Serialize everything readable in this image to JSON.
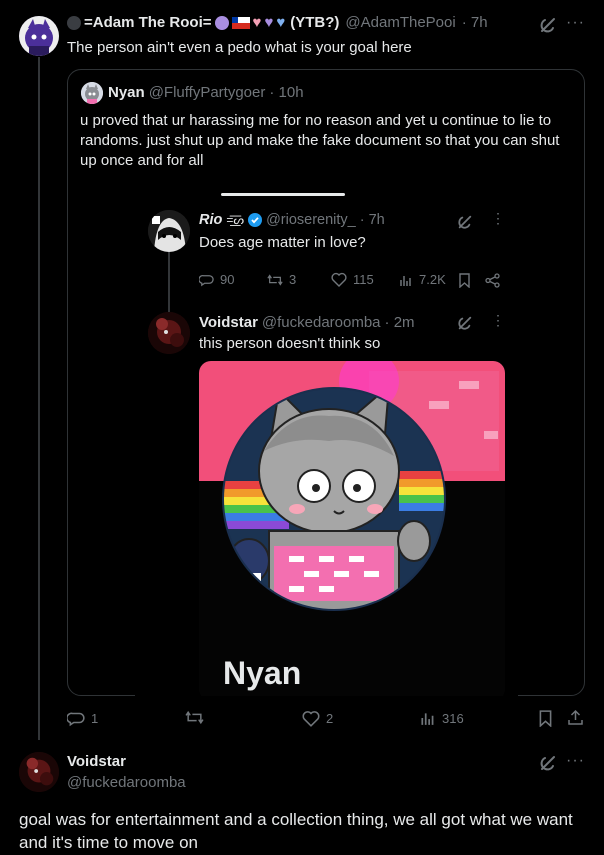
{
  "tweet1": {
    "name": "=Adam The Rooi=",
    "name_suffix": "(YTB?)",
    "handle": "@AdamThePooi",
    "time": "· 7h",
    "text": "The person ain't even a pedo what is your goal here",
    "actions": {
      "replies": "1",
      "retweets": "",
      "likes": "2",
      "views": "316"
    }
  },
  "quote": {
    "name": "Nyan",
    "handle": "@FluffyPartygoer",
    "time": "· 10h",
    "text": "u proved that ur harassing me for no reason and yet u continue to lie to randoms. just shut up and make the fake document so that you can shut up once and for all"
  },
  "screenshot": {
    "tweet_a": {
      "name": "Rio",
      "name_decor": "=͟͟͞͞ᔕ",
      "handle": "@rioserenity_",
      "time": "· 7h",
      "text": "Does age matter in love?",
      "actions": {
        "replies": "90",
        "retweets": "3",
        "likes": "115",
        "views": "7.2K"
      }
    },
    "tweet_b": {
      "name": "Voidstar",
      "handle": "@fuckedaroomba",
      "time": "· 2m",
      "text": "this person doesn't think so",
      "image_caption": "Nyan"
    }
  },
  "tweet2": {
    "name": "Voidstar",
    "handle": "@fuckedaroomba",
    "text": "goal was for entertainment and a collection thing, we all got what we want and it's time to move on"
  },
  "colors": {
    "background": "#000000",
    "text": "#e7e9ea",
    "muted": "#71767b",
    "border": "#2f3336",
    "verified": "#1d9bf0",
    "heart_pink": "#f4a0b5",
    "heart_purple": "#a98ee0",
    "heart_blue": "#7fb0f0"
  },
  "icons": [
    "grok-icon",
    "more-icon",
    "reply-icon",
    "retweet-icon",
    "like-icon",
    "views-icon",
    "bookmark-icon",
    "share-icon",
    "verified-icon"
  ]
}
